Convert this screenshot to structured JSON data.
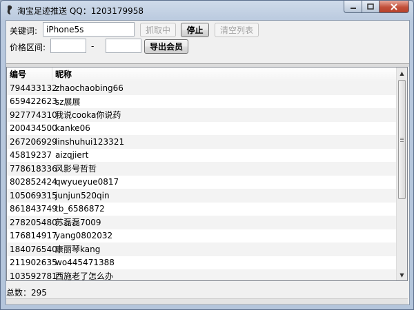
{
  "window": {
    "title": "淘宝足迹推送 QQ：1203179958",
    "icons": [
      "app-icon",
      "minimize-icon",
      "maximize-icon",
      "close-icon"
    ]
  },
  "toolbar": {
    "keyword_label": "关键词:",
    "keyword_value": "iPhone5s",
    "fetching_button": "抓取中",
    "stop_button": "停止",
    "clear_button": "清空列表",
    "price_label": "价格区间:",
    "price_min": "",
    "price_max": "",
    "price_dash": "-",
    "export_button": "导出会员"
  },
  "list": {
    "columns": [
      "编号",
      "昵称"
    ],
    "rows": [
      [
        "794433132",
        "zhaochaobing66"
      ],
      [
        "659422623",
        "sz展展"
      ],
      [
        "927774310",
        "我说cooka你说药"
      ],
      [
        "200434500",
        "kanke06"
      ],
      [
        "267206929",
        "linshuhui123321"
      ],
      [
        "45819237",
        "aizqjiert"
      ],
      [
        "778618336",
        "风影号哲哲"
      ],
      [
        "802852424",
        "qwyueyue0817"
      ],
      [
        "105069315",
        "junjun520qin"
      ],
      [
        "861843749",
        "tb_6586872"
      ],
      [
        "278205480",
        "苏磊磊7009"
      ],
      [
        "176814917",
        "yang0802032"
      ],
      [
        "184076540",
        "康丽琴kang"
      ],
      [
        "211902635",
        "wo445471388"
      ],
      [
        "103592781",
        "西施老了怎么办"
      ]
    ]
  },
  "status": {
    "total_label": "总数：295"
  },
  "colors": {
    "title_bar": "#c4d3e6",
    "close_button": "#c2503a",
    "row_alt": "#f3f3f3"
  }
}
